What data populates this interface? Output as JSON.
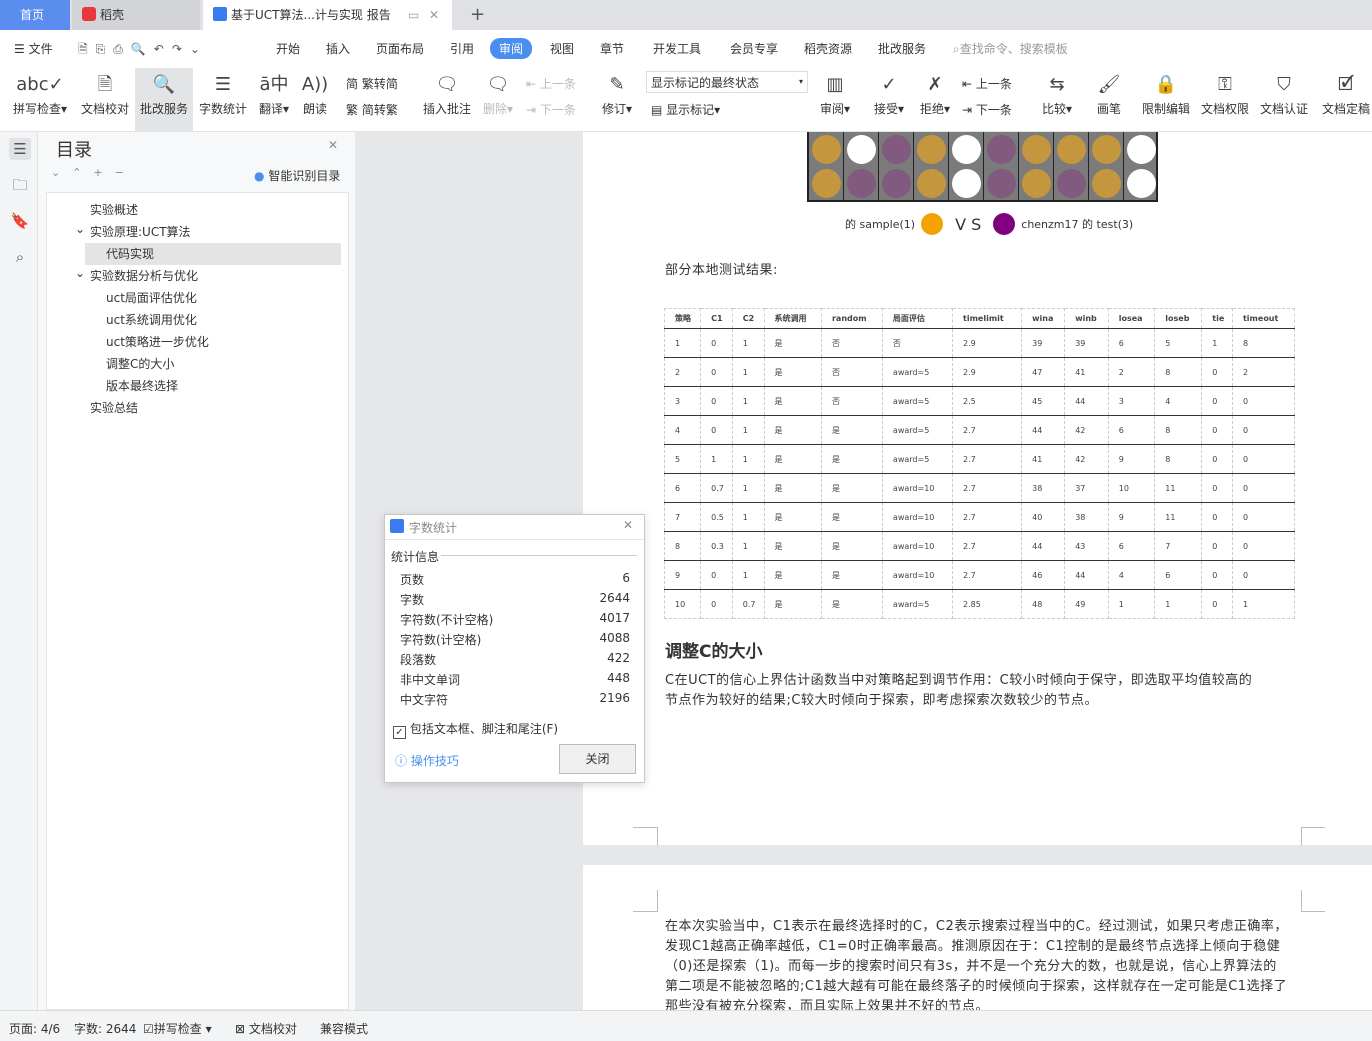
{
  "tabs": {
    "home": "首页",
    "docer": "稻壳",
    "doc": "基于UCT算法...计与实现 报告"
  },
  "menu": {
    "file": "文件",
    "items": [
      "开始",
      "插入",
      "页面布局",
      "引用",
      "审阅",
      "视图",
      "章节",
      "开发工具",
      "会员专享",
      "稻壳资源",
      "批改服务"
    ],
    "active": "审阅",
    "search": "查找命令、搜索模板"
  },
  "ribbon": {
    "spell": "拼写检查",
    "proof": "文档校对",
    "correct": "批改服务",
    "wordcount": "字数统计",
    "translate": "翻译",
    "read": "朗读",
    "t2s": "繁转简",
    "s2t": "简转繁",
    "insert_comment": "插入批注",
    "delete": "删除",
    "prev_comment": "上一条",
    "next_comment": "下一条",
    "revise": "修订",
    "markup_select": "显示标记的最终状态",
    "show_markup": "显示标记",
    "review": "审阅",
    "accept": "接受",
    "reject": "拒绝",
    "prev": "上一条",
    "next": "下一条",
    "compare": "比较",
    "pen": "画笔",
    "restrict": "限制编辑",
    "permission": "文档权限",
    "certify": "文档认证",
    "finalize": "文档定稿"
  },
  "nav": {
    "title": "目录",
    "smart": "智能识别目录",
    "items": [
      {
        "label": "实验概述",
        "level": 1
      },
      {
        "label": "实验原理:UCT算法",
        "level": 1,
        "expanded": true
      },
      {
        "label": "代码实现",
        "level": 2,
        "selected": true
      },
      {
        "label": "实验数据分析与优化",
        "level": 1,
        "expanded": true
      },
      {
        "label": "uct局面评估优化",
        "level": 2
      },
      {
        "label": "uct系统调用优化",
        "level": 2
      },
      {
        "label": "uct策略进一步优化",
        "level": 2
      },
      {
        "label": "调整C的大小",
        "level": 2
      },
      {
        "label": "版本最终选择",
        "level": 2
      },
      {
        "label": "实验总结",
        "level": 1
      }
    ]
  },
  "doc": {
    "board": [
      [
        "gold",
        "white",
        "purple",
        "gold",
        "white",
        "purple",
        "gold",
        "gold",
        "gold",
        "white"
      ],
      [
        "gold",
        "purple",
        "purple",
        "gold",
        "white",
        "purple",
        "gold",
        "purple",
        "gold",
        "white"
      ]
    ],
    "board_colors": {
      "gold": "#c4973e",
      "white": "#ffffff",
      "purple": "#82597f"
    },
    "vs_left": "的 sample(1)",
    "vs": "V S",
    "vs_right": "chenzm17 的 test(3)",
    "results_label": "部分本地测试结果:",
    "table": {
      "headers": [
        "策略",
        "C1",
        "C2",
        "系统调用",
        "random",
        "局面评估",
        "timelimit",
        "wina",
        "winb",
        "losea",
        "loseb",
        "tie",
        "timeout"
      ],
      "rows": [
        [
          "1",
          "0",
          "1",
          "是",
          "否",
          "否",
          "2.9",
          "39",
          "39",
          "6",
          "5",
          "1",
          "8"
        ],
        [
          "2",
          "0",
          "1",
          "是",
          "否",
          "award=5",
          "2.9",
          "47",
          "41",
          "2",
          "8",
          "0",
          "2"
        ],
        [
          "3",
          "0",
          "1",
          "是",
          "否",
          "award=5",
          "2.5",
          "45",
          "44",
          "3",
          "4",
          "0",
          "0"
        ],
        [
          "4",
          "0",
          "1",
          "是",
          "是",
          "award=5",
          "2.7",
          "44",
          "42",
          "6",
          "8",
          "0",
          "0"
        ],
        [
          "5",
          "1",
          "1",
          "是",
          "是",
          "award=5",
          "2.7",
          "41",
          "42",
          "9",
          "8",
          "0",
          "0"
        ],
        [
          "6",
          "0.7",
          "1",
          "是",
          "是",
          "award=10",
          "2.7",
          "38",
          "37",
          "10",
          "11",
          "0",
          "0"
        ],
        [
          "7",
          "0.5",
          "1",
          "是",
          "是",
          "award=10",
          "2.7",
          "40",
          "38",
          "9",
          "11",
          "0",
          "0"
        ],
        [
          "8",
          "0.3",
          "1",
          "是",
          "是",
          "award=10",
          "2.7",
          "44",
          "43",
          "6",
          "7",
          "0",
          "0"
        ],
        [
          "9",
          "0",
          "1",
          "是",
          "是",
          "award=10",
          "2.7",
          "46",
          "44",
          "4",
          "6",
          "0",
          "0"
        ],
        [
          "10",
          "0",
          "0.7",
          "是",
          "是",
          "award=5",
          "2.85",
          "48",
          "49",
          "1",
          "1",
          "0",
          "1"
        ]
      ]
    },
    "heading": "调整C的大小",
    "para1": "C在UCT的信心上界估计函数当中对策略起到调节作用：C较小时倾向于保守，即选取平均值较高的节点作为较好的结果;C较大时倾向于探索，即考虑探索次数较少的节点。",
    "para2": "在本次实验当中，C1表示在最终选择时的C，C2表示搜索过程当中的C。经过测试，如果只考虑正确率，发现C1越高正确率越低，C1=0时正确率最高。推测原因在于：C1控制的是最终节点选择上倾向于稳健（0)还是探索（1)。而每一步的搜索时间只有3s，并不是一个充分大的数，也就是说，信心上界算法的第二项是不能被忽略的;C1越大越有可能在最终落子的时候倾向于探索，这样就存在一定可能是C1选择了那些没有被充分探索，而且实际上效果并不好的节点。"
  },
  "dialog": {
    "title": "字数统计",
    "section": "统计信息",
    "stats": [
      [
        "页数",
        "6"
      ],
      [
        "字数",
        "2644"
      ],
      [
        "字符数(不计空格)",
        "4017"
      ],
      [
        "字符数(计空格)",
        "4088"
      ],
      [
        "段落数",
        "422"
      ],
      [
        "非中文单词",
        "448"
      ],
      [
        "中文字符",
        "2196"
      ]
    ],
    "include": "包括文本框、脚注和尾注(F)",
    "tips": "操作技巧",
    "close": "关闭"
  },
  "status": {
    "page": "页面: 4/6",
    "words": "字数: 2644",
    "spell": "拼写检查",
    "proof": "文档校对",
    "compat": "兼容模式"
  }
}
